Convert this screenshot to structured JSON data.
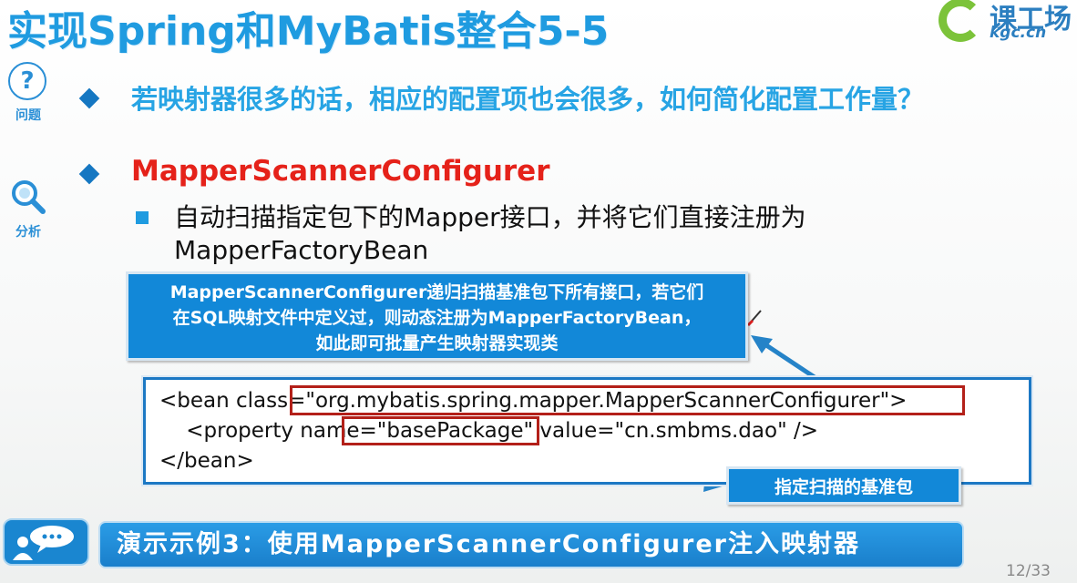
{
  "slide": {
    "title": "实现Spring和MyBatis整合5-5",
    "page": "12/33"
  },
  "logo": {
    "text_cn": "课工场",
    "text_en": "kgc.cn"
  },
  "rail": [
    {
      "icon": "question-icon",
      "glyph": "?",
      "label": "问题"
    },
    {
      "icon": "magnifier-icon",
      "glyph": "",
      "label": "分析"
    }
  ],
  "content": {
    "question": "若映射器很多的话，相应的配置项也会很多，如何简化配置工作量？",
    "heading": "MapperScannerConfigurer",
    "sub_line1": "自动扫描指定包下的Mapper接口，并将它们直接注册为",
    "sub_line2": "MapperFactoryBean"
  },
  "callout": {
    "line1": "MapperScannerConfigurer递归扫描基准包下所有接口，若它们",
    "line2": "在SQL映射文件中定义过，则动态注册为MapperFactoryBean，",
    "line3": "如此即可批量产生映射器实现类"
  },
  "code": {
    "line1": "<bean class=\"org.mybatis.spring.mapper.MapperScannerConfigurer\">",
    "line2": "    <property name=\"basePackage\" value=\"cn.smbms.dao\" />",
    "line3": "</bean>"
  },
  "package_label": "指定扫描的基准包",
  "demo": {
    "text": "演示示例3：使用MapperScannerConfigurer注入映射器"
  },
  "colors": {
    "title": "#1f9be0",
    "heading_red": "#e5221a",
    "callout_blue": "#1288d8",
    "highlight_red": "#b32019"
  }
}
